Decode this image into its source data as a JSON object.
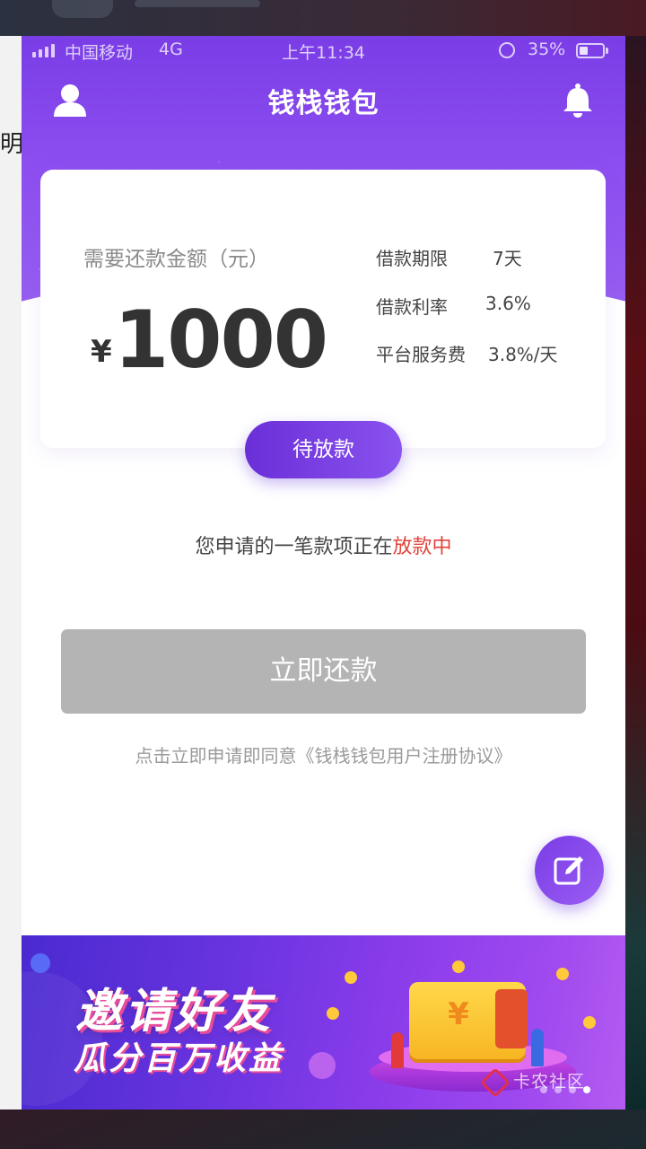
{
  "background_app": {
    "edge_char": "明"
  },
  "status_bar": {
    "carrier": "中国移动",
    "network": "4G",
    "time": "上午11:34",
    "battery": "35%"
  },
  "header": {
    "title": "钱栈钱包",
    "profile_icon": "user-icon",
    "notification_icon": "bell-icon"
  },
  "loan_card": {
    "amount_label": "需要还款金额（元）",
    "currency_symbol": "¥",
    "amount": "1000",
    "term_label": "借款期限",
    "term_value": "7天",
    "rate_label": "借款利率",
    "rate_value": "3.6%",
    "fee_label": "平台服务费",
    "fee_value": "3.8%/天"
  },
  "status": {
    "badge": "待放款"
  },
  "notice": {
    "prefix": "您申请的一笔款项正在",
    "highlight": "放款中",
    "highlight_color": "#e2433c"
  },
  "actions": {
    "repay_button": "立即还款",
    "agreement": "点击立即申请即同意《钱栈钱包用户注册协议》"
  },
  "fab": {
    "icon": "edit-icon"
  },
  "banner": {
    "title": "邀请好友",
    "subtitle": "瓜分百万收益",
    "illustration_symbol": "¥",
    "watermark": "卡农社区",
    "slide_count": 4,
    "active_slide": 4
  },
  "colors": {
    "brand_purple": "#7a3de6",
    "button_disabled": "#b4b4b4",
    "highlight_red": "#e2433c"
  }
}
